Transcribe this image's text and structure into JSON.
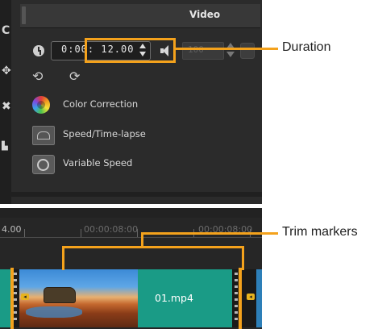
{
  "panel": {
    "tab_label": "Video",
    "timecode_value": "0:00: 12.00",
    "volume_value": "100"
  },
  "menu": {
    "color_correction": "Color Correction",
    "speed_timelapse": "Speed/Time-lapse",
    "variable_speed": "Variable Speed"
  },
  "timeline": {
    "ruler_left_label": "4.00",
    "ruler_mid_label": "00:00:08:00",
    "ruler_right_label": "00:00:08:00",
    "clip_name": "01.mp4"
  },
  "annotations": {
    "duration": "Duration",
    "trim_markers": "Trim markers"
  },
  "colors": {
    "accent_orange": "#f4a21c",
    "clip_teal": "#1a9b86",
    "panel_dark": "#2b2b2b"
  },
  "icons": [
    "clock-icon",
    "spin-arrows-icon",
    "speaker-icon",
    "rotate-left-icon",
    "rotate-right-icon",
    "color-wheel-icon",
    "speed-icon",
    "variable-speed-icon",
    "film-sprocket-icon"
  ]
}
